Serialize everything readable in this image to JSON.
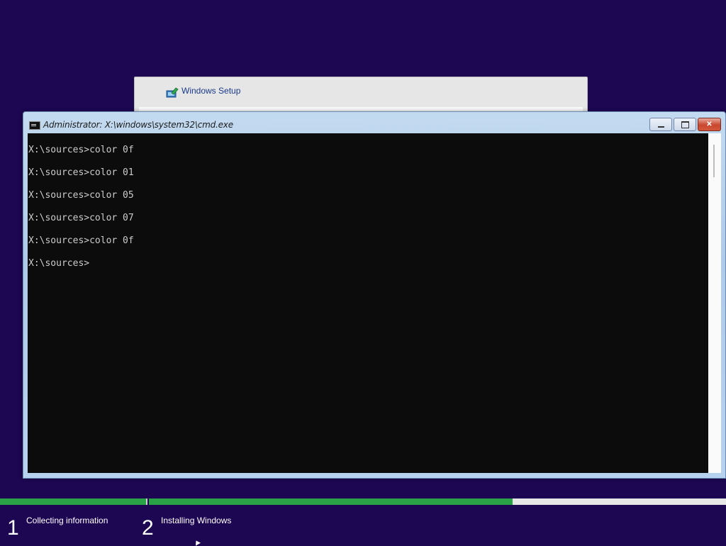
{
  "setup_window": {
    "title": "Windows Setup",
    "icon": "setup-icon"
  },
  "cmd_window": {
    "title": "Administrator: X:\\windows\\system32\\cmd.exe",
    "icon": "cmd-icon",
    "buttons": {
      "minimize": "minimize-icon",
      "maximize": "maximize-icon",
      "close": "close-icon"
    },
    "background_color": "#0c0c0c",
    "text_color": "#cccccc",
    "lines": [
      "X:\\sources>color 0f",
      "X:\\sources>color 01",
      "X:\\sources>color 05",
      "X:\\sources>color 07",
      "X:\\sources>color 0f",
      "X:\\sources>"
    ]
  },
  "progress": {
    "accent_color": "#29a346",
    "step1_fraction": 1.0,
    "step2_fraction": 0.63
  },
  "steps": [
    {
      "number": "1",
      "label": "Collecting information"
    },
    {
      "number": "2",
      "label": "Installing Windows"
    }
  ],
  "colors": {
    "desktop_background": "#1d0652"
  }
}
